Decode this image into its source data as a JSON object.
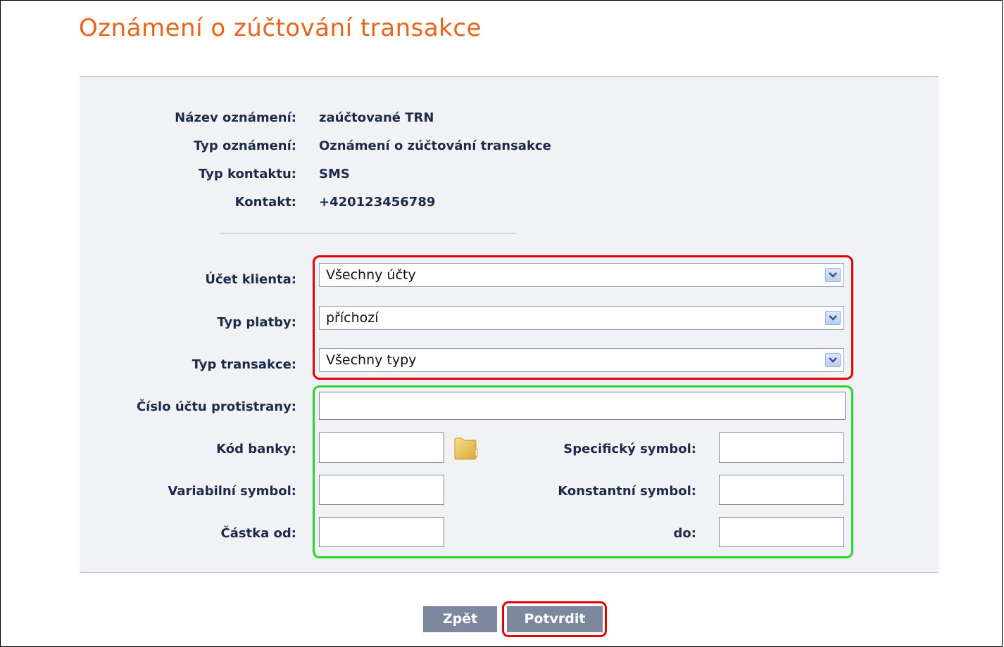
{
  "page": {
    "title": "Oznámení o zúčtování transakce"
  },
  "info": {
    "name_label": "Název oznámení:",
    "name_value": "zaúčtované TRN",
    "type_label": "Typ oznámení:",
    "type_value": "Oznámení o zúčtování transakce",
    "contact_type_label": "Typ kontaktu:",
    "contact_type_value": "SMS",
    "contact_label": "Kontakt:",
    "contact_value": "+420123456789"
  },
  "filters": {
    "account_label": "Účet klienta:",
    "account_value": "Všechny účty",
    "payment_type_label": "Typ platby:",
    "payment_type_value": "příchozí",
    "transaction_type_label": "Typ transakce:",
    "transaction_type_value": "Všechny typy",
    "counter_account_label": "Číslo účtu protistrany:",
    "counter_account_value": "",
    "bank_code_label": "Kód banky:",
    "bank_code_value": "",
    "specific_symbol_label": "Specifický symbol:",
    "specific_symbol_value": "",
    "variable_symbol_label": "Variabilní symbol:",
    "variable_symbol_value": "",
    "constant_symbol_label": "Konstantní symbol:",
    "constant_symbol_value": "",
    "amount_from_label": "Částka od:",
    "amount_from_value": "",
    "amount_to_label": "do:",
    "amount_to_value": ""
  },
  "actions": {
    "back_label": "Zpět",
    "confirm_label": "Potvrdit"
  },
  "colors": {
    "title": "#e8641b",
    "label": "#1d2a4a",
    "panel_bg": "#f1f2f5",
    "button_bg": "#7d879d",
    "highlight_red": "#e40000",
    "highlight_green": "#2bd42b"
  }
}
